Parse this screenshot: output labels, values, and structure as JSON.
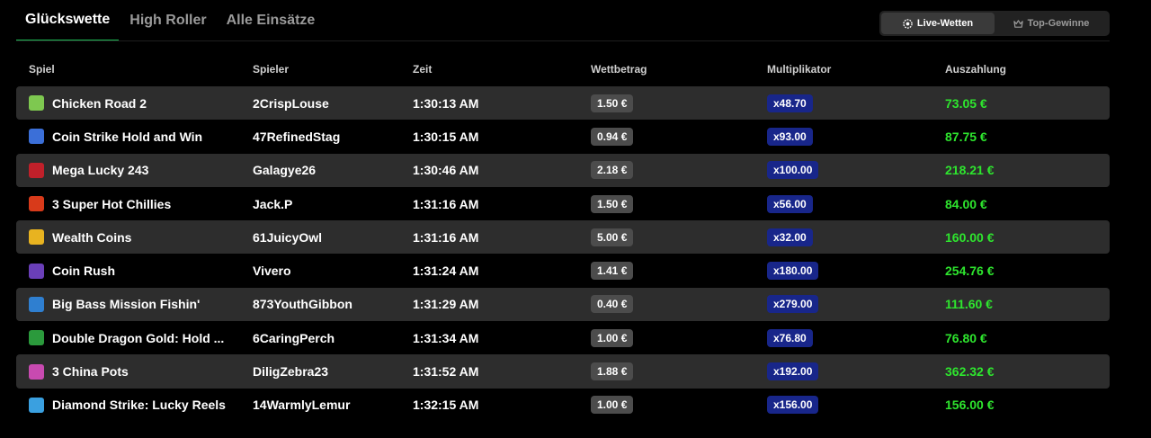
{
  "tabs": [
    {
      "label": "Glückswette",
      "active": true
    },
    {
      "label": "High Roller",
      "active": false
    },
    {
      "label": "Alle Einsätze",
      "active": false
    }
  ],
  "toggle": {
    "live_label": "Live-Wetten",
    "top_label": "Top-Gewinne"
  },
  "headers": {
    "game": "Spiel",
    "player": "Spieler",
    "time": "Zeit",
    "bet": "Wettbetrag",
    "multiplier": "Multiplikator",
    "payout": "Auszahlung"
  },
  "colors": {
    "accent": "#1db954",
    "payout": "#2ee62e",
    "multiplier_badge": "#18268a",
    "bet_badge": "#4c4c4c"
  },
  "rows": [
    {
      "game": "Chicken Road 2",
      "player": "2CrispLouse",
      "time": "1:30:13 AM",
      "bet": "1.50 €",
      "multiplier": "x48.70",
      "payout": "73.05 €",
      "icon": "chicken-game-icon",
      "icon_color": "#7ec850"
    },
    {
      "game": "Coin Strike Hold and Win",
      "player": "47RefinedStag",
      "time": "1:30:15 AM",
      "bet": "0.94 €",
      "multiplier": "x93.00",
      "payout": "87.75 €",
      "icon": "coin-game-icon",
      "icon_color": "#3b6fd8"
    },
    {
      "game": "Mega Lucky 243",
      "player": "Galagye26",
      "time": "1:30:46 AM",
      "bet": "2.18 €",
      "multiplier": "x100.00",
      "payout": "218.21 €",
      "icon": "lucky-game-icon",
      "icon_color": "#c0202a"
    },
    {
      "game": "3 Super Hot Chillies",
      "player": "Jack.P",
      "time": "1:31:16 AM",
      "bet": "1.50 €",
      "multiplier": "x56.00",
      "payout": "84.00 €",
      "icon": "chilli-game-icon",
      "icon_color": "#d83a1a"
    },
    {
      "game": "Wealth Coins",
      "player": "61JuicyOwl",
      "time": "1:31:16 AM",
      "bet": "5.00 €",
      "multiplier": "x32.00",
      "payout": "160.00 €",
      "icon": "wealth-coin-game-icon",
      "icon_color": "#e8b320"
    },
    {
      "game": "Coin Rush",
      "player": "Vivero",
      "time": "1:31:24 AM",
      "bet": "1.41 €",
      "multiplier": "x180.00",
      "payout": "254.76 €",
      "icon": "coin-rush-game-icon",
      "icon_color": "#6a3fb8"
    },
    {
      "game": "Big Bass Mission Fishin'",
      "player": "873YouthGibbon",
      "time": "1:31:29 AM",
      "bet": "0.40 €",
      "multiplier": "x279.00",
      "payout": "111.60 €",
      "icon": "bass-fish-game-icon",
      "icon_color": "#2f7fd0"
    },
    {
      "game": "Double Dragon Gold: Hold ...",
      "player": "6CaringPerch",
      "time": "1:31:34 AM",
      "bet": "1.00 €",
      "multiplier": "x76.80",
      "payout": "76.80 €",
      "icon": "dragon-game-icon",
      "icon_color": "#2b9a3c"
    },
    {
      "game": "3 China Pots",
      "player": "DiligZebra23",
      "time": "1:31:52 AM",
      "bet": "1.88 €",
      "multiplier": "x192.00",
      "payout": "362.32 €",
      "icon": "china-pots-game-icon",
      "icon_color": "#c84ab0"
    },
    {
      "game": "Diamond Strike: Lucky Reels",
      "player": "14WarmlyLemur",
      "time": "1:32:15 AM",
      "bet": "1.00 €",
      "multiplier": "x156.00",
      "payout": "156.00 €",
      "icon": "diamond-game-icon",
      "icon_color": "#3aa0e0"
    }
  ]
}
